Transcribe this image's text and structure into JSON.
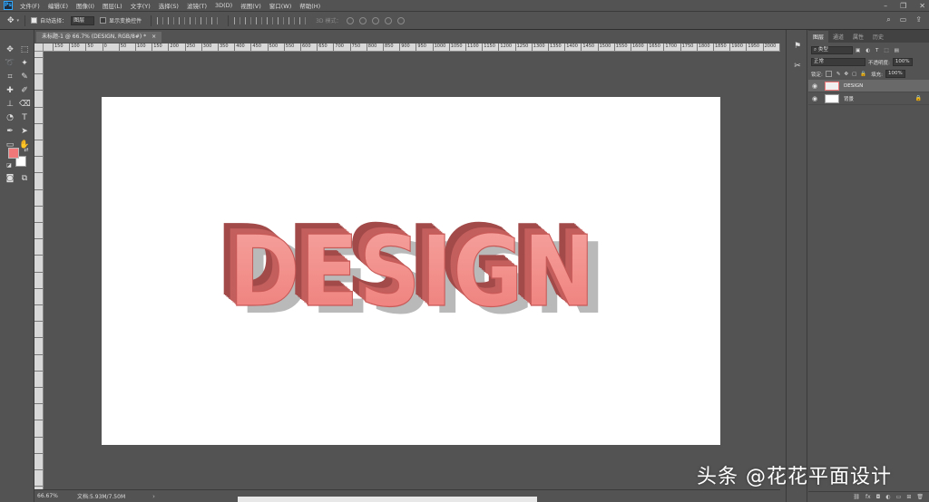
{
  "app": {
    "logo": "Ps"
  },
  "menu": [
    "文件(F)",
    "编辑(E)",
    "图像(I)",
    "图层(L)",
    "文字(Y)",
    "选择(S)",
    "滤镜(T)",
    "3D(D)",
    "视图(V)",
    "窗口(W)",
    "帮助(H)"
  ],
  "options": {
    "auto_select_label": "自动选择：",
    "auto_select_value": "图层",
    "show_transform_label": "显示变换控件",
    "mode_3d_label": "3D 模式："
  },
  "document": {
    "tab_title": "未标题-1 @ 66.7% (DESIGN, RGB/8#) *",
    "close_glyph": "×",
    "canvas_text": "DESIGN",
    "text_color": "#f07878",
    "ruler_labels": [
      "150",
      "100",
      "50",
      "0",
      "50",
      "100",
      "150",
      "200",
      "250",
      "300",
      "350",
      "400",
      "450",
      "500",
      "550",
      "600",
      "650",
      "700",
      "750",
      "800",
      "850",
      "900",
      "950",
      "1000",
      "1050",
      "1100",
      "1150",
      "1200",
      "1250",
      "1300",
      "1350",
      "1400",
      "1450",
      "1500",
      "1550",
      "1600",
      "1650",
      "1700",
      "1750",
      "1800",
      "1850",
      "1900",
      "1950",
      "2000",
      "2050"
    ]
  },
  "status": {
    "zoom": "66.67%",
    "doc_info": "文档:5.93M/7.50M"
  },
  "colors": {
    "foreground": "#f07878",
    "background": "#ffffff"
  },
  "panel": {
    "tabs": [
      "图层",
      "通道",
      "属性",
      "历史"
    ],
    "kind_label": "类型",
    "blend_mode": "正常",
    "opacity_label": "不透明度:",
    "opacity_value": "100%",
    "lock_label": "锁定:",
    "fill_label": "填充:",
    "fill_value": "100%",
    "layers": [
      {
        "name": "DESIGN",
        "type": "text",
        "active": true
      },
      {
        "name": "背景",
        "type": "background",
        "active": false
      }
    ]
  },
  "watermark": "头条 @花花平面设计"
}
